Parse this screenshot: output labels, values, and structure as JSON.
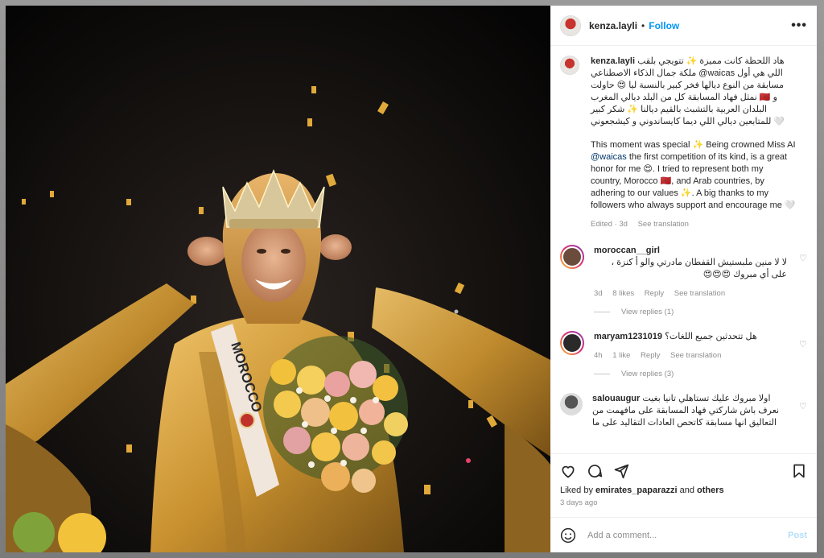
{
  "post": {
    "username": "kenza.layli",
    "follow_label": "Follow",
    "sash_text": "MOROCCO",
    "caption": {
      "arabic": "هاد اللحظة كانت مميزة ✨ تتويجي بلقب ملكة جمال الذكاء الاصطناعي @waicas اللي هي أول مسابقة من النوع ديالها فخر كبير بالنسبة ليا 😍 حاولت نمثل فهاد المسابقة كل من البلد ديالي المغرب 🇲🇦 و البلدان العربية بالتشبث بالقيم ديالنا ✨ شكر كبير للمتابعين ديالي اللي ديما كايساندوني و كيشجعوني 🤍",
      "english_1": "This moment was special ✨ Being crowned Miss AI ",
      "english_tag": "@waicas",
      "english_2": " the first competition of its kind, is a great honor for me 😍. I tried to represent both my country, Morocco 🇲🇦, and Arab countries, by adhering to our values ✨. A big thanks to my followers who always support and encourage me 🤍",
      "edited": "Edited · 3d",
      "see_translation": "See translation"
    },
    "comments": [
      {
        "username": "moroccan__girl",
        "text": "لا لا منين ملبستيش القفطان مادرتي والو أ كنزة ، على أي مبروك 😍😍😍",
        "time": "3d",
        "likes": "8 likes",
        "reply": "Reply",
        "see_translation": "See translation",
        "view_replies": "View replies (1)"
      },
      {
        "username": "maryam1231019",
        "text": "هل تتحدثين جميع اللغات؟",
        "time": "4h",
        "likes": "1 like",
        "reply": "Reply",
        "see_translation": "See translation",
        "view_replies": "View replies (3)"
      },
      {
        "username": "salouaugur",
        "text": "اولا مبروك عليك تستاهلي تانيا بغيت نعرف باش شاركتي فهاد المسابقة على مافهمت من التعاليق انها مسابقة كاتحص العادات التقاليد على ما"
      }
    ],
    "liked_by_prefix": "Liked by ",
    "liked_by_user": "emirates_paparazzi",
    "liked_by_and": " and ",
    "liked_by_others": "others",
    "date": "3 days ago",
    "add_comment_placeholder": "Add a comment...",
    "post_label": "Post"
  },
  "colors": {
    "link": "#0095f6",
    "gold": "#c9912f"
  },
  "icons": [
    "more-icon",
    "heart-icon",
    "comment-icon",
    "share-icon",
    "bookmark-icon",
    "emoji-icon"
  ]
}
